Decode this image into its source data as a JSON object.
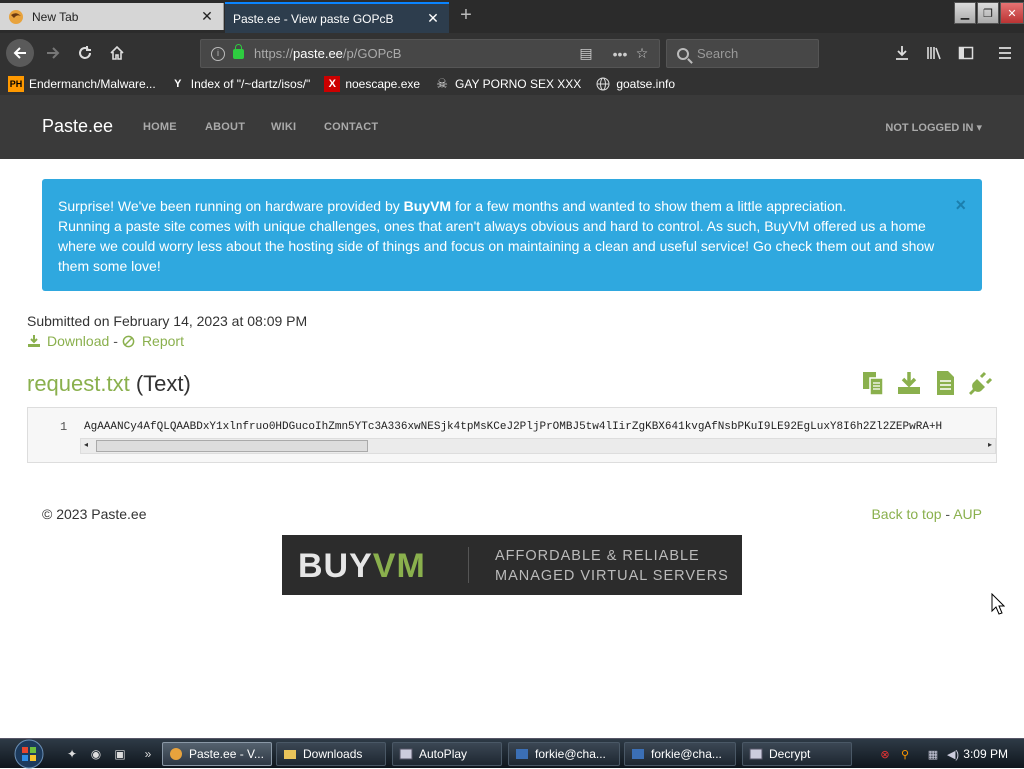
{
  "browser": {
    "tabs": [
      {
        "title": "New Tab",
        "active": false
      },
      {
        "title": "Paste.ee - View paste GOPcB",
        "active": true
      }
    ],
    "url_prefix": "https://",
    "url_host": "paste.ee",
    "url_path": "/p/GOPcB",
    "search_placeholder": "Search",
    "bookmarks": [
      {
        "label": "Endermanch/Malware...",
        "icon": "pornhub-icon"
      },
      {
        "label": "Index of \"/~dartz/isos/\"",
        "icon": "ycombinator-icon"
      },
      {
        "label": "noescape.exe",
        "icon": "x-icon"
      },
      {
        "label": "GAY PORNO SEX XXX",
        "icon": "skull-icon"
      },
      {
        "label": "goatse.info",
        "icon": "globe-icon"
      }
    ]
  },
  "site": {
    "brand": "Paste.ee",
    "nav": [
      "HOME",
      "ABOUT",
      "WIKI",
      "CONTACT"
    ],
    "login": "NOT LOGGED IN",
    "alert": {
      "line1_a": "Surprise! We've been running on hardware provided by ",
      "line1_b": "BuyVM",
      "line1_c": " for a few months and wanted to show them a little appreciation.",
      "line2": "Running a paste site comes with unique challenges, ones that aren't always obvious and hard to control. As such, BuyVM offered us a home where we could worry less about the hosting side of things and focus on maintaining a clean and useful service! Go check them out and show them some love!",
      "close": "×"
    },
    "submitted": "Submitted on February 14, 2023 at 08:09 PM",
    "download_label": "Download",
    "separator": "-",
    "report_label": "Report",
    "file_name": "request.txt",
    "file_type": "(Text)",
    "code": {
      "line_number": "1",
      "content": "AgAAANCy4AfQLQAABDxY1xlnfruo0HDGucoIhZmn5YTc3A336xwNESjk4tpMsKCeJ2PljPrOMBJ5tw4lIirZgKBX641kvgAfNsbPKuI9LE92EgLuxY8I6h2Zl2ZEPwRA+H"
    },
    "copyright": "© 2023 Paste.ee",
    "back_to_top": "Back to top",
    "aup": "AUP",
    "banner": {
      "buy": "BUY",
      "vm": "VM",
      "tag1": "AFFORDABLE & RELIABLE",
      "tag2": "MANAGED VIRTUAL SERVERS"
    }
  },
  "taskbar": {
    "items": [
      {
        "label": "Paste.ee - V...",
        "active": true
      },
      {
        "label": "Downloads",
        "active": false
      },
      {
        "label": "AutoPlay",
        "active": false
      },
      {
        "label": "forkie@cha...",
        "active": false
      },
      {
        "label": "forkie@cha...",
        "active": false
      },
      {
        "label": "Decrypt",
        "active": false
      }
    ],
    "clock": "3:09 PM"
  },
  "colors": {
    "accent_green": "#8ab04d",
    "alert_blue": "#2fa8df",
    "header_dark": "#3a3a3a"
  }
}
